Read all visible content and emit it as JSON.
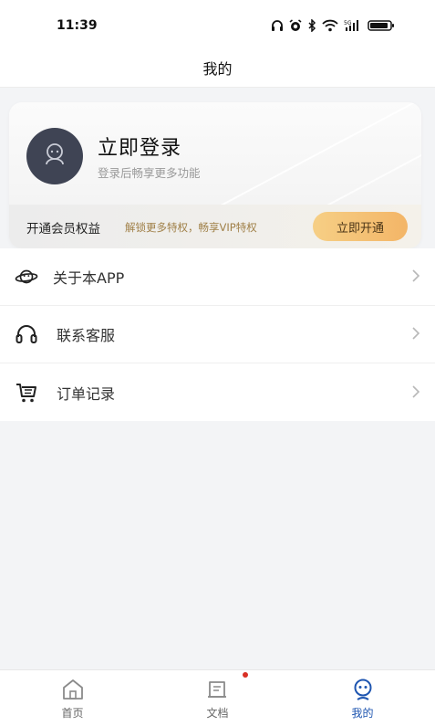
{
  "status_bar": {
    "time": "11:39",
    "icons": [
      "headphones-icon",
      "alarm-icon",
      "bluetooth-icon",
      "wifi-icon",
      "signal-icon",
      "battery-icon"
    ]
  },
  "header": {
    "title": "我的"
  },
  "profile": {
    "login_title": "立即登录",
    "login_subtitle": "登录后畅享更多功能",
    "avatar_icon": "user-avatar-icon"
  },
  "vip": {
    "title": "开通会员权益",
    "description": "解锁更多特权，畅享VIP特权",
    "button_label": "立即开通"
  },
  "menu": {
    "items": [
      {
        "label": "关于本APP",
        "icon": "planet-icon"
      },
      {
        "label": "联系客服",
        "icon": "headset-icon"
      },
      {
        "label": "订单记录",
        "icon": "cart-icon"
      }
    ]
  },
  "bottom_nav": {
    "items": [
      {
        "label": "首页",
        "icon": "home-icon",
        "active": false
      },
      {
        "label": "文档",
        "icon": "document-icon",
        "active": false,
        "badge_dot": true
      },
      {
        "label": "我的",
        "icon": "profile-icon",
        "active": true
      }
    ]
  },
  "colors": {
    "accent": "#1e55b0",
    "vip_button_start": "#f6cf85",
    "vip_button_end": "#f3b567",
    "avatar_bg": "#3f4454",
    "badge_red": "#d93025"
  }
}
